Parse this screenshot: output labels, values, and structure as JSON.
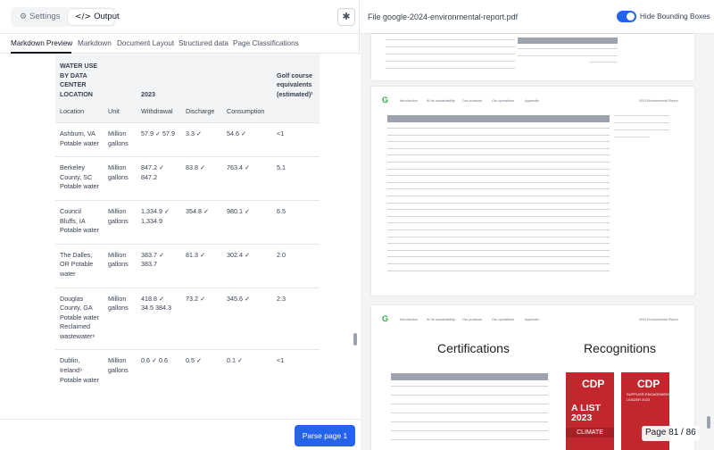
{
  "left_panel": {
    "mode_tabs": [
      {
        "label": "Settings",
        "icon": "gear-icon"
      },
      {
        "label": "Output",
        "icon": "code-icon"
      }
    ],
    "debug_icon": "bug-icon",
    "view_tabs": [
      "Markdown Preview",
      "Markdown",
      "Document Layout",
      "Structured data",
      "Page Classifications"
    ],
    "active_view_tab": "Markdown Preview",
    "table": {
      "header_top": [
        "WATER USE BY DATA CENTER LOCATION",
        "",
        "2023",
        "",
        "",
        "Golf course equivalents (estimated)¹"
      ],
      "header_sub": [
        "Location",
        "Unit",
        "Withdrawal",
        "Discharge",
        "Consumption",
        ""
      ],
      "rows": [
        [
          "Ashburn, VA Potable water",
          "Million gallons",
          "57.9 ✓ 57.9",
          "3.3 ✓",
          "54.6 ✓",
          "<1"
        ],
        [
          "Berkeley County, SC Potable water",
          "Million gallons",
          "847.2 ✓ 847.2",
          "83.8 ✓",
          "763.4 ✓",
          "5.1"
        ],
        [
          "Council Bluffs, IA Potable water",
          "Million gallons",
          "1,334.9 ✓ 1,334.9",
          "354.8 ✓",
          "980.1 ✓",
          "6.5"
        ],
        [
          "The Dalles, OR Potable water",
          "Million gallons",
          "383.7 ✓ 383.7",
          "81.3 ✓",
          "302.4 ✓",
          "2.0"
        ],
        [
          "Douglas County, GA Potable water Reclaimed wastewater⁹",
          "Million gallons",
          "418.8 ✓ 34.5 384.3",
          "73.2 ✓",
          "345.6 ✓",
          "2.3"
        ],
        [
          "Dublin, Ireland⁹ Potable water",
          "Million gallons",
          "0.6 ✓ 0.6",
          "0.5 ✓",
          "0.1 ✓",
          "<1"
        ]
      ]
    },
    "parse_button": "Parse page 1"
  },
  "right_panel": {
    "file_name": "File google-2024-environmental-report.pdf",
    "toggle_label": "Hide Bounding Boxes",
    "toggle_on": true,
    "page3": {
      "nav": [
        "Introduction",
        "AI for sustainability",
        "Our products",
        "Our operations",
        "Appendix"
      ],
      "report_label": "2024 Environmental Report",
      "title_left": "Certifications",
      "title_right": "Recognitions",
      "badges": [
        {
          "brand": "CDP",
          "line1": "A LIST",
          "line2": "2023",
          "line3": "CLIMATE"
        },
        {
          "brand": "CDP",
          "line1": "SUPPLIER ENGAGEMENT",
          "line2": "LEADER 2023",
          "line3": ""
        }
      ]
    },
    "page2_nav": [
      "Introduction",
      "AI for sustainability",
      "Our products",
      "Our operations",
      "Appendix"
    ],
    "page2_report_label": "2024 Environmental Report",
    "page_indicator": "Page 81 / 86"
  },
  "colors": {
    "accent_blue": "#2563eb",
    "cdp_red": "#c1272d",
    "google_green": "#34a853"
  }
}
